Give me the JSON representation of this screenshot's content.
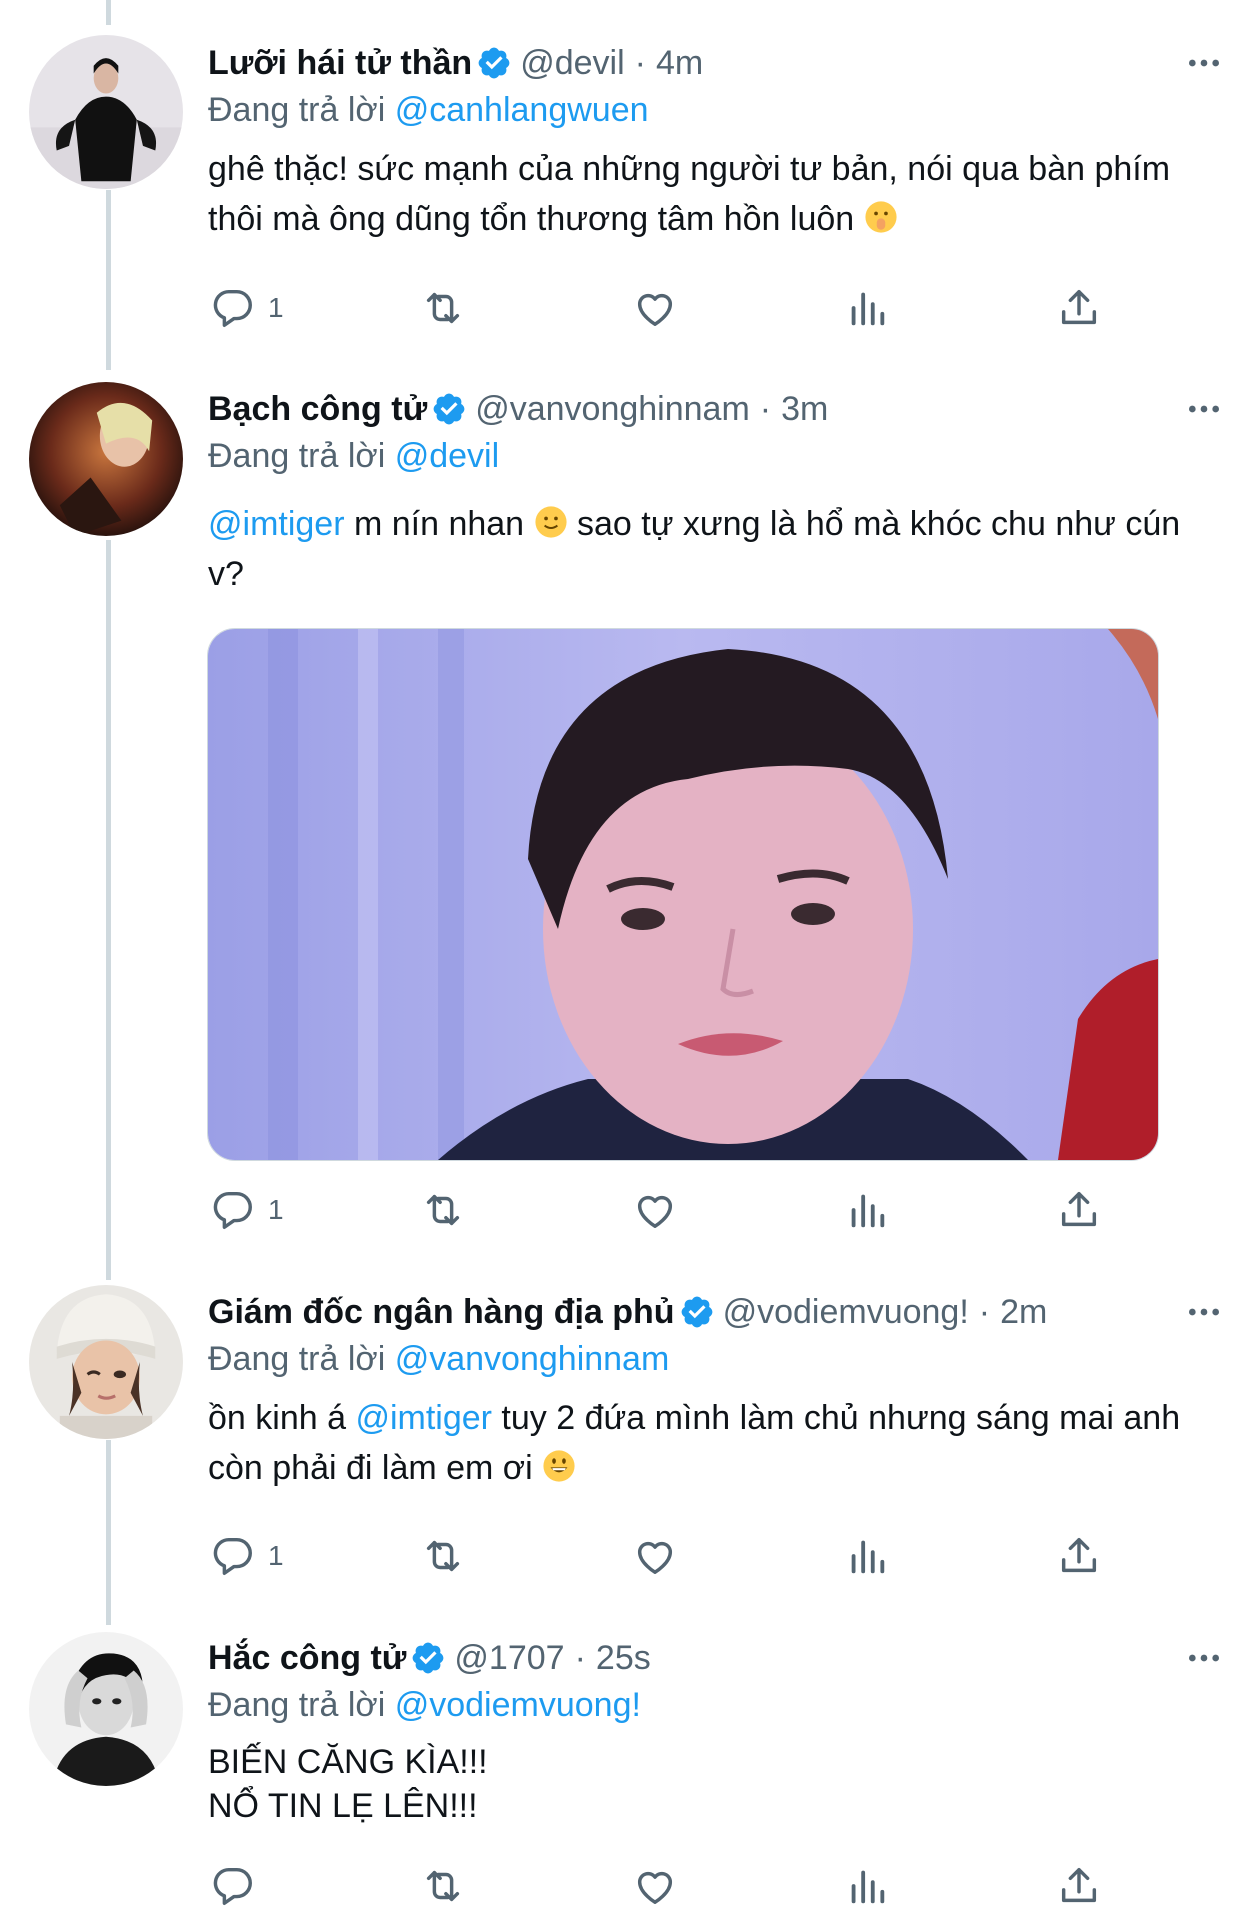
{
  "colors": {
    "accent": "#1d9bf0",
    "muted": "#536471",
    "text": "#0f1419",
    "line": "#cfd9de"
  },
  "icons": [
    "verified-badge-icon",
    "more-icon",
    "reply-icon",
    "retweet-icon",
    "like-icon",
    "views-icon",
    "share-icon"
  ],
  "tweets": [
    {
      "name": "Lưỡi hái tử thần",
      "handle": "@devil",
      "dot": "·",
      "time": "4m",
      "replying_label": "Đang trả lời",
      "replying_to": "@canhlangwuen",
      "text_line1": "ghê thặc! sức mạnh của những người tư bản, nói qua bàn phím",
      "text_line2": "thôi mà ông dũng tổn thương tâm hồn luôn",
      "emoji": "shushing-face-emoji",
      "reply_count": "1"
    },
    {
      "name": "Bạch công tử",
      "handle": "@vanvonghinnam",
      "dot": "·",
      "time": "3m",
      "replying_label": "Đang trả lời",
      "replying_to": "@devil",
      "mention": "@imtiger",
      "text_line1_a": " m nín nhan ",
      "text_line1_b": " sao tự xưng là hổ mà khóc chu như cún",
      "text_line2": "v?",
      "emoji": "slightly-smiling-face-emoji",
      "media": "photo of a sulking young man",
      "reply_count": "1"
    },
    {
      "name": "Giám đốc ngân hàng địa phủ",
      "handle": "@vodiemvuong!",
      "dot": "·",
      "time": "2m",
      "replying_label": "Đang trả lời",
      "replying_to": "@vanvonghinnam",
      "text_line1_a": "ồn kinh á ",
      "mention": "@imtiger",
      "text_line1_b": " tuy 2 đứa mình làm chủ nhưng sáng mai anh",
      "text_line2": "còn phải đi làm em ơi ",
      "emoji": "grinning-face-emoji",
      "reply_count": "1"
    },
    {
      "name": "Hắc công tử",
      "handle": "@1707",
      "dot": "·",
      "time": "25s",
      "replying_label": "Đang trả lời",
      "replying_to": "@vodiemvuong!",
      "text_line1": "BIẾN CĂNG KÌA!!!",
      "text_line2": "NỔ TIN LẸ LÊN!!!"
    }
  ]
}
